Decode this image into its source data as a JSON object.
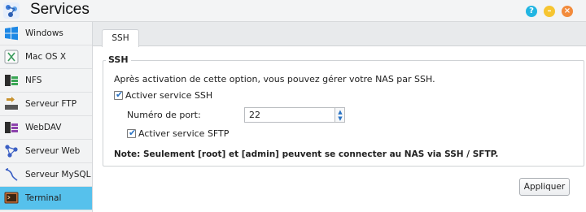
{
  "window": {
    "title": "Services",
    "app_icon": "services-icon",
    "buttons": {
      "help": "?",
      "minimize": "–",
      "close": "×"
    }
  },
  "sidebar": {
    "items": [
      {
        "label": "Windows",
        "icon": "windows-icon"
      },
      {
        "label": "Mac OS X",
        "icon": "mac-icon"
      },
      {
        "label": "NFS",
        "icon": "nfs-icon"
      },
      {
        "label": "Serveur FTP",
        "icon": "ftp-icon"
      },
      {
        "label": "WebDAV",
        "icon": "webdav-icon"
      },
      {
        "label": "Serveur Web",
        "icon": "web-server-icon"
      },
      {
        "label": "Serveur MySQL",
        "icon": "mysql-icon"
      },
      {
        "label": "Terminal",
        "icon": "terminal-icon",
        "active": true
      }
    ]
  },
  "tabs": [
    {
      "label": "SSH",
      "active": true
    }
  ],
  "ssh": {
    "legend": "SSH",
    "description": "Après activation de cette option, vous pouvez gérer votre NAS par SSH.",
    "enable_ssh_label": "Activer service SSH",
    "enable_ssh_checked": true,
    "port_label": "Numéro de port:",
    "port_value": "22",
    "enable_sftp_label": "Activer service SFTP",
    "enable_sftp_checked": true,
    "note": "Note: Seulement [root] et [admin] peuvent se connecter au NAS via SSH / SFTP.",
    "check_glyph": "✔",
    "spin_up": "▲",
    "spin_down": "▼"
  },
  "footer": {
    "apply_label": "Appliquer"
  },
  "colors": {
    "accent": "#56c1ec",
    "help": "#21b5e2",
    "minimize": "#f6c531",
    "close": "#f28b3c"
  }
}
